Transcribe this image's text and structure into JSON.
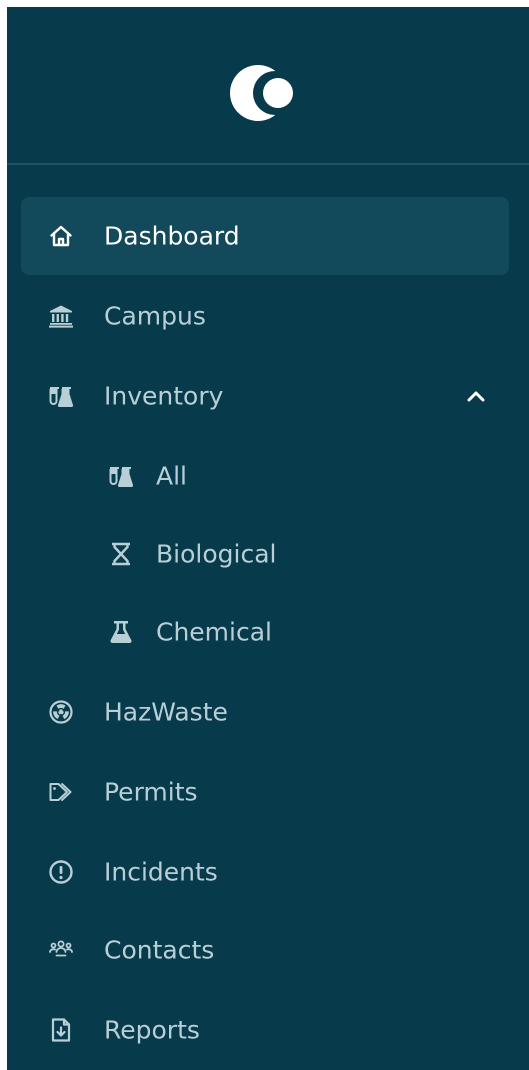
{
  "colors": {
    "background": "#073a4b",
    "active_background": "#134a5b",
    "text": "#b9cfd6",
    "active_text": "#ffffff",
    "divider": "#1a5366"
  },
  "logo": {
    "icon": "crescent-moon-logo"
  },
  "nav": {
    "items": [
      {
        "label": "Dashboard",
        "icon": "home-icon",
        "active": true
      },
      {
        "label": "Campus",
        "icon": "building-columns-icon"
      },
      {
        "label": "Inventory",
        "icon": "flasks-icon",
        "expanded": true,
        "chevron": "chevron-up-icon"
      },
      {
        "label": "All",
        "icon": "flasks-icon",
        "level": 1
      },
      {
        "label": "Biological",
        "icon": "hourglass-icon",
        "level": 1
      },
      {
        "label": "Chemical",
        "icon": "flask-icon",
        "level": 1
      },
      {
        "label": "HazWaste",
        "icon": "radiation-icon"
      },
      {
        "label": "Permits",
        "icon": "tags-icon"
      },
      {
        "label": "Incidents",
        "icon": "exclamation-circle-icon"
      },
      {
        "label": "Contacts",
        "icon": "users-icon"
      },
      {
        "label": "Reports",
        "icon": "file-report-icon"
      }
    ]
  }
}
